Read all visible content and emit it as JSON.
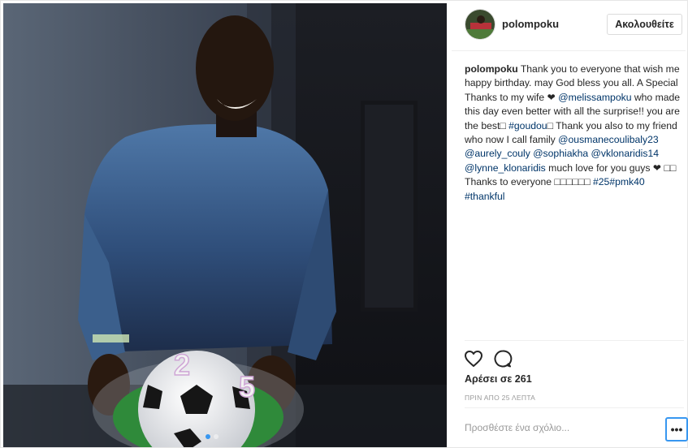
{
  "header": {
    "username": "polompoku",
    "follow_label": "Ακολουθείτε"
  },
  "caption": {
    "user": "polompoku",
    "t1": " Thank you to everyone that wish me happy birthday. may God bless you all. A Special Thanks to my wife ❤ ",
    "m_wife": "@melissampoku",
    "t2": " who made this day even better with all the surprise!! you are the best□ ",
    "h_goudou": "#goudou",
    "t3": "□ Thank you also to my friend who now I call family ",
    "m1": "@ousmanecoulibaly23",
    "m2": "@aurely_couly",
    "m3": "@sophiakha",
    "m4": "@vklonaridis14",
    "m5": "@lynne_klonaridis",
    "t4": " much love for you guys ❤ □□ Thanks to everyone □□□□□□ ",
    "h1": "#25",
    "h2": "#pmk40",
    "h3": "#thankful"
  },
  "engagement": {
    "likes": "Αρέσει σε 261",
    "timestamp": "ΠΡΙΝ ΑΠΟ 25 ΛΕΠΤΑ"
  },
  "comment": {
    "placeholder": "Προσθέστε ένα σχόλιο..."
  },
  "more_label": "•••",
  "icons": {
    "like": "heart-icon",
    "comment": "comment-bubble-icon"
  },
  "colors": {
    "link": "#003569",
    "accent": "#3897f0",
    "muted": "#999999"
  },
  "carousel": {
    "current": 1,
    "total": 2
  }
}
